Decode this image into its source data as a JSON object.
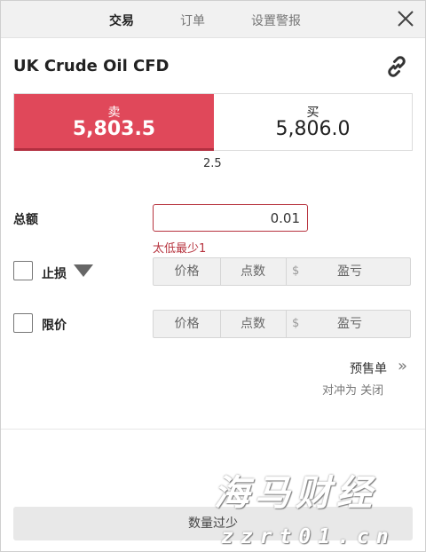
{
  "tabs": [
    {
      "label": "交易",
      "active": true
    },
    {
      "label": "订单",
      "active": false
    },
    {
      "label": "设置警报",
      "active": false
    }
  ],
  "instrument": {
    "title": "UK Crude Oil CFD"
  },
  "prices": {
    "sell_label": "卖",
    "sell_value": "5,803.5",
    "buy_label": "买",
    "buy_value": "5,806.0",
    "spread": "2.5"
  },
  "amount": {
    "label": "总额",
    "value": "0.01",
    "error": "太低最少1"
  },
  "stop_loss": {
    "label": "止损",
    "price": "价格",
    "points": "点数",
    "currency": "$",
    "pl": "盈亏"
  },
  "limit": {
    "label": "限价",
    "price": "价格",
    "points": "点数",
    "currency": "$",
    "pl": "盈亏"
  },
  "preorder": {
    "label": "预售单",
    "hedge": "对冲为 关闭"
  },
  "submit": {
    "label": "数量过少"
  },
  "watermark": {
    "line1": "海马财经",
    "line2": "zzrt01.cn"
  },
  "colors": {
    "sell_bg": "#e0485a",
    "error": "#b7343f"
  }
}
